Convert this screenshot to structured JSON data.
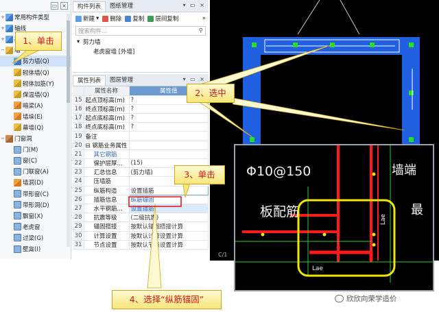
{
  "tree": {
    "items": [
      {
        "label": "常用构件类型",
        "expander": "+",
        "icon": "folder",
        "child": false
      },
      {
        "label": "轴线",
        "expander": "+",
        "icon": "axis",
        "child": false
      },
      {
        "label": "柱",
        "expander": "+",
        "icon": "column",
        "child": false
      },
      {
        "label": "墙",
        "expander": "−",
        "icon": "wall-group",
        "child": false
      },
      {
        "label": "剪力墙(Q)",
        "expander": "",
        "icon": "shear-wall",
        "child": true,
        "selected": true
      },
      {
        "label": "砌体墙(Q)",
        "expander": "",
        "icon": "masonry-wall",
        "child": true
      },
      {
        "label": "砌体加筋(Y)",
        "expander": "",
        "icon": "masonry-rebar",
        "child": true
      },
      {
        "label": "保温墙(Q)",
        "expander": "",
        "icon": "insulation-wall",
        "child": true
      },
      {
        "label": "暗梁(A)",
        "expander": "",
        "icon": "hidden-beam",
        "child": true
      },
      {
        "label": "墙垛(E)",
        "expander": "",
        "icon": "wall-pier",
        "child": true
      },
      {
        "label": "幕墙(Q)",
        "expander": "",
        "icon": "curtain-wall",
        "child": true
      },
      {
        "label": "门窗洞",
        "expander": "−",
        "icon": "opening-group",
        "child": false
      },
      {
        "label": "门(M)",
        "expander": "",
        "icon": "door",
        "child": true
      },
      {
        "label": "窗(C)",
        "expander": "",
        "icon": "window",
        "child": true
      },
      {
        "label": "门联窗(A)",
        "expander": "",
        "icon": "door-window",
        "child": true
      },
      {
        "label": "墙洞(D)",
        "expander": "",
        "icon": "wall-hole",
        "child": true
      },
      {
        "label": "带形窗(C)",
        "expander": "",
        "icon": "strip-window",
        "child": true
      },
      {
        "label": "带形洞(D)",
        "expander": "",
        "icon": "strip-hole",
        "child": true
      },
      {
        "label": "飘窗(X)",
        "expander": "",
        "icon": "bay-window",
        "child": true
      },
      {
        "label": "老虎窗",
        "expander": "",
        "icon": "dormer",
        "child": true
      },
      {
        "label": "过梁(G)",
        "expander": "",
        "icon": "lintel",
        "child": true
      },
      {
        "label": "壁龛(I)",
        "expander": "",
        "icon": "niche",
        "child": true
      }
    ]
  },
  "component_panel": {
    "tabs": [
      "构件列表",
      "图纸管理"
    ],
    "toolbar": {
      "new": "新建",
      "delete": "删除",
      "copy": "复制",
      "layer_copy": "层间复制"
    },
    "search_placeholder": "搜索构件...",
    "group": "剪力墙",
    "item": "老虎窗墙 [外墙]"
  },
  "property_panel": {
    "tabs": [
      "属性列表",
      "图层管理"
    ],
    "headers": {
      "name": "属性名称",
      "value": "属性值"
    },
    "rows": [
      {
        "num": "15",
        "name": "起点顶标高(m)",
        "value": "?",
        "style": ""
      },
      {
        "num": "16",
        "name": "终点顶标高(m)",
        "value": "?",
        "style": ""
      },
      {
        "num": "17",
        "name": "起点底标高(m)",
        "value": "?",
        "style": ""
      },
      {
        "num": "18",
        "name": "终点底标高(m)",
        "value": "?",
        "style": ""
      },
      {
        "num": "19",
        "name": "备注",
        "value": "",
        "style": ""
      },
      {
        "num": "20",
        "name": "⊟ 钢筋业务属性",
        "value": "",
        "style": "grp"
      },
      {
        "num": "21",
        "name": "其它钢筋",
        "value": "",
        "style": "ind blue"
      },
      {
        "num": "22",
        "name": "保护层厚...",
        "value": "(15)",
        "style": "ind"
      },
      {
        "num": "23",
        "name": "汇总信息",
        "value": "(剪力墙)",
        "style": "ind"
      },
      {
        "num": "24",
        "name": "压墙筋",
        "value": "",
        "style": "ind"
      },
      {
        "num": "25",
        "name": "纵筋构造",
        "value": "设置插筋",
        "style": "ind"
      },
      {
        "num": "26",
        "name": "插筋信息",
        "value": "纵筋锚固",
        "style": "ind"
      },
      {
        "num": "27",
        "name": "水平钢筋...",
        "value": "设置插筋",
        "style": "ind"
      },
      {
        "num": "28",
        "name": "抗震等级",
        "value": "(二级抗震)",
        "style": "ind"
      },
      {
        "num": "29",
        "name": "锚固搭接",
        "value": "按默认锚固搭接计算",
        "style": "ind"
      },
      {
        "num": "30",
        "name": "计算设置",
        "value": "按默认计算设置计算",
        "style": "ind"
      },
      {
        "num": "31",
        "name": "节点设置",
        "value": "按默认节点设置计算",
        "style": "ind"
      }
    ]
  },
  "cad": {
    "rebar_label": "Φ10@150",
    "slab_label": "板配筋",
    "end_label": "墙端",
    "right_label": "最",
    "lae": "Lae",
    "status": "C/1"
  },
  "callouts": {
    "step1": "1、单击",
    "step2": "2、选中",
    "step3": "3、单击",
    "step4": "4、选择“纵筋锚固”"
  },
  "watermark": "欣欣向荣学造价",
  "colors": {
    "callout_text": "#d4141a",
    "callout_bg": "#f7e67a",
    "wall_blue": "#1f5fe0",
    "rebar_red": "#ff1a1a",
    "highlight_yellow": "#f2e600",
    "node_green": "#25e025"
  }
}
